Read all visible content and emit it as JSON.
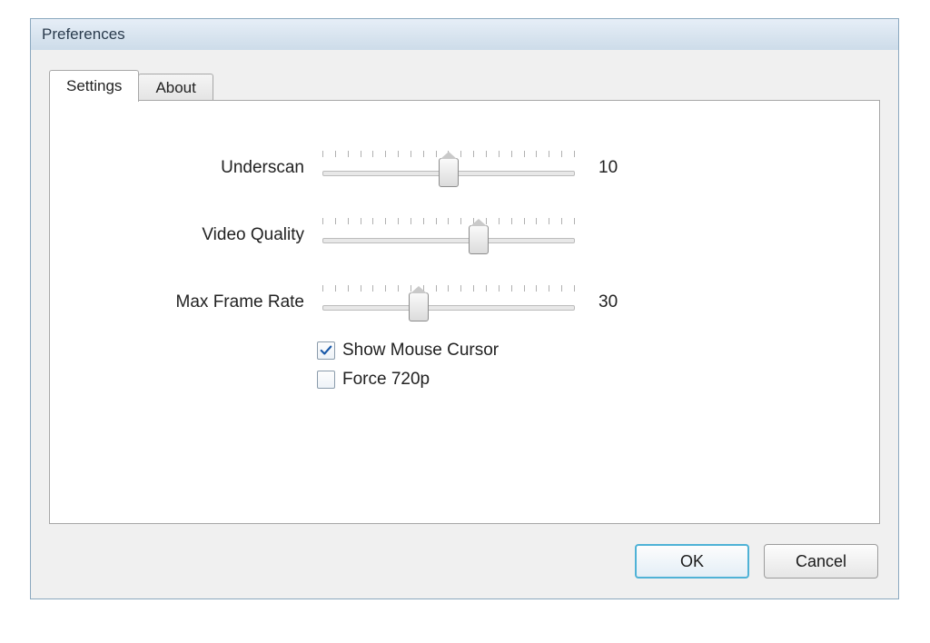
{
  "dialog": {
    "title": "Preferences"
  },
  "tabs": {
    "settings": "Settings",
    "about": "About",
    "active": "settings"
  },
  "sliders": {
    "underscan": {
      "label": "Underscan",
      "value_text": "10",
      "position_percent": 50
    },
    "video_quality": {
      "label": "Video Quality",
      "value_text": "",
      "position_percent": 62
    },
    "max_frame_rate": {
      "label": "Max Frame Rate",
      "value_text": "30",
      "position_percent": 38
    }
  },
  "checkboxes": {
    "show_mouse_cursor": {
      "label": "Show Mouse Cursor",
      "checked": true
    },
    "force_720p": {
      "label": "Force 720p",
      "checked": false
    }
  },
  "buttons": {
    "ok": "OK",
    "cancel": "Cancel"
  }
}
